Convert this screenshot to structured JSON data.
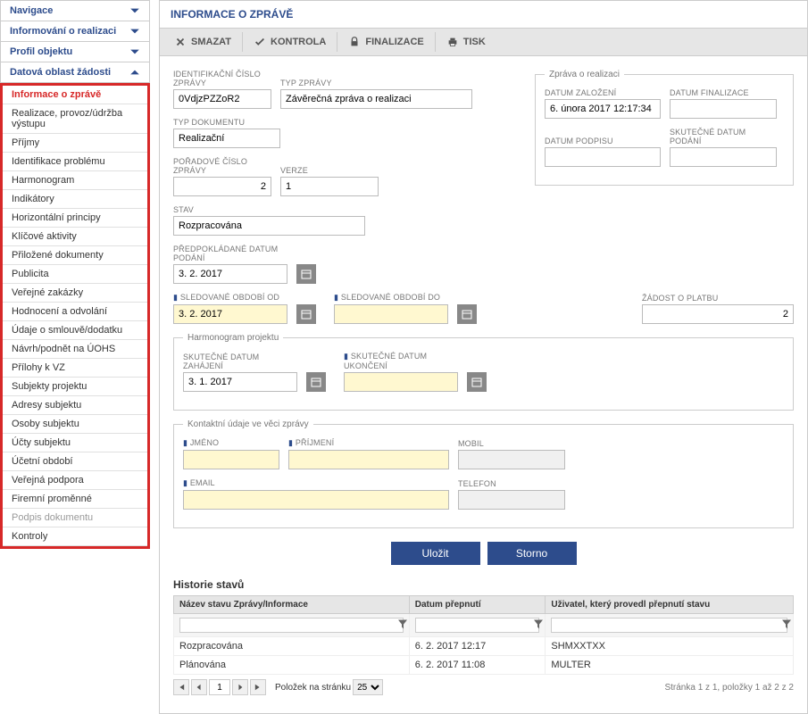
{
  "sidebar": {
    "sections": [
      {
        "label": "Navigace",
        "expanded": false
      },
      {
        "label": "Informování o realizaci",
        "expanded": false
      },
      {
        "label": "Profil objektu",
        "expanded": false
      },
      {
        "label": "Datová oblast žádosti",
        "expanded": true
      }
    ],
    "menu": [
      {
        "label": "Informace o zprávě",
        "active": true
      },
      {
        "label": "Realizace, provoz/údržba výstupu"
      },
      {
        "label": "Příjmy"
      },
      {
        "label": "Identifikace problému"
      },
      {
        "label": "Harmonogram"
      },
      {
        "label": "Indikátory"
      },
      {
        "label": "Horizontální principy"
      },
      {
        "label": "Klíčové aktivity"
      },
      {
        "label": "Přiložené dokumenty"
      },
      {
        "label": "Publicita"
      },
      {
        "label": "Veřejné zakázky"
      },
      {
        "label": "Hodnocení a odvolání"
      },
      {
        "label": "Údaje o smlouvě/dodatku"
      },
      {
        "label": "Návrh/podnět na ÚOHS"
      },
      {
        "label": "Přílohy k VZ"
      },
      {
        "label": "Subjekty projektu"
      },
      {
        "label": "Adresy subjektu"
      },
      {
        "label": "Osoby subjektu"
      },
      {
        "label": "Účty subjektu"
      },
      {
        "label": "Účetní období"
      },
      {
        "label": "Veřejná podpora"
      },
      {
        "label": "Firemní proměnné"
      },
      {
        "label": "Podpis dokumentu",
        "disabled": true
      },
      {
        "label": "Kontroly"
      }
    ]
  },
  "header": {
    "title": "INFORMACE O ZPRÁVĚ"
  },
  "toolbar": {
    "smazat": "SMAZAT",
    "kontrola": "KONTROLA",
    "finalizace": "FINALIZACE",
    "tisk": "TISK"
  },
  "form": {
    "id_label": "IDENTIFIKAČNÍ ČÍSLO ZPRÁVY",
    "id_value": "0VdjzPZZoR2",
    "typ_zpravy_label": "TYP ZPRÁVY",
    "typ_zpravy_value": "Závěrečná zpráva o realizaci",
    "typ_dok_label": "TYP DOKUMENTU",
    "typ_dok_value": "Realizační",
    "poradove_label": "POŘADOVÉ ČÍSLO ZPRÁVY",
    "poradove_value": "2",
    "verze_label": "VERZE",
    "verze_value": "1",
    "stav_label": "STAV",
    "stav_value": "Rozpracována",
    "predpokl_label": "PŘEDPOKLÁDANÉ DATUM PODÁNÍ",
    "predpokl_value": "3. 2. 2017",
    "sled_od_label": "SLEDOVANÉ OBDOBÍ OD",
    "sled_od_value": "3. 2. 2017",
    "sled_do_label": "SLEDOVANÉ OBDOBÍ DO",
    "sled_do_value": "",
    "zadost_platbu_label": "ŽÁDOST O PLATBU",
    "zadost_platbu_value": "2"
  },
  "zprava_box": {
    "legend": "Zpráva o realizaci",
    "zalozeni_label": "DATUM ZALOŽENÍ",
    "zalozeni_value": "6. února 2017 12:17:34",
    "finalizace_label": "DATUM FINALIZACE",
    "finalizace_value": "",
    "podpis_label": "DATUM PODPISU",
    "podpis_value": "",
    "skut_podani_label": "SKUTEČNÉ DATUM PODÁNÍ",
    "skut_podani_value": ""
  },
  "harmonogram": {
    "legend": "Harmonogram projektu",
    "zahajeni_label": "SKUTEČNÉ DATUM ZAHÁJENÍ",
    "zahajeni_value": "3. 1. 2017",
    "ukonceni_label": "SKUTEČNÉ DATUM UKONČENÍ",
    "ukonceni_value": ""
  },
  "kontakt": {
    "legend": "Kontaktní údaje ve věci zprávy",
    "jmeno_label": "JMÉNO",
    "jmeno_value": "",
    "prijmeni_label": "PŘÍJMENÍ",
    "prijmeni_value": "",
    "mobil_label": "MOBIL",
    "mobil_value": "",
    "email_label": "EMAIL",
    "email_value": "",
    "telefon_label": "TELEFON",
    "telefon_value": ""
  },
  "buttons": {
    "save": "Uložit",
    "cancel": "Storno"
  },
  "history": {
    "title": "Historie stavů",
    "cols": [
      "Název stavu Zprávy/Informace",
      "Datum přepnutí",
      "Uživatel, který provedl přepnutí stavu"
    ],
    "rows": [
      {
        "name": "Rozpracována",
        "date": "6. 2. 2017 12:17",
        "user": "SHMXXTXX"
      },
      {
        "name": "Plánována",
        "date": "6. 2. 2017 11:08",
        "user": "MULTER"
      }
    ]
  },
  "pager": {
    "page": "1",
    "per_page_label": "Položek na stránku",
    "per_page": "25",
    "summary": "Stránka 1 z 1, položky 1 až 2 z 2"
  }
}
